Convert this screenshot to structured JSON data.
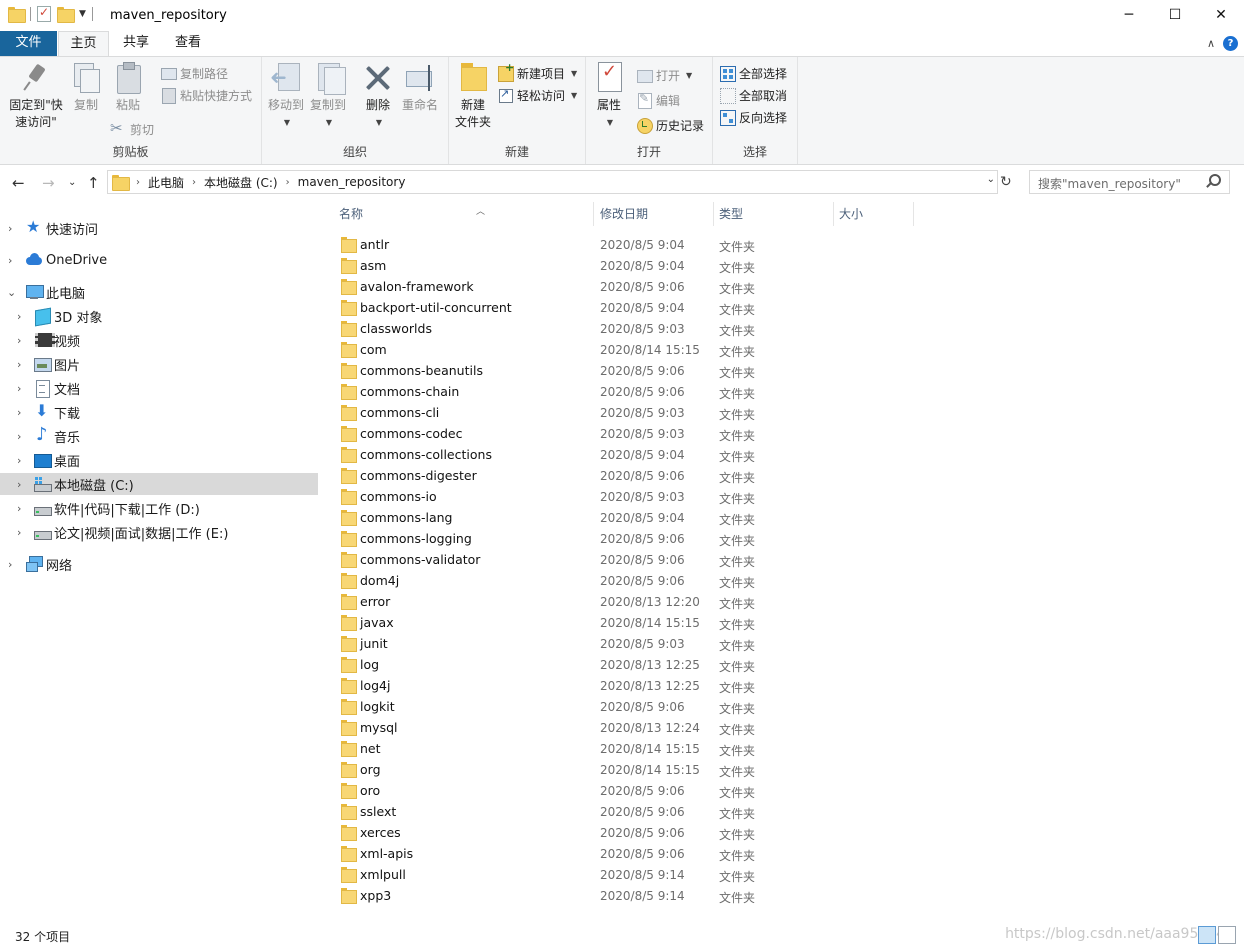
{
  "window": {
    "title": "maven_repository",
    "minimize": "─",
    "maximize": "☐",
    "close": "✕"
  },
  "tabs": {
    "file": "文件",
    "home": "主页",
    "share": "共享",
    "view": "查看",
    "collapse": "∧",
    "help": "?"
  },
  "ribbon": {
    "clipboard": {
      "label": "剪贴板",
      "pin": "固定到\"快\n速访问\"",
      "copy": "复制",
      "paste": "粘贴",
      "copy_path": "复制路径",
      "paste_shortcut": "粘贴快捷方式",
      "cut": "剪切"
    },
    "organize": {
      "label": "组织",
      "move_to": "移动到",
      "copy_to": "复制到",
      "delete": "删除",
      "rename": "重命名"
    },
    "new": {
      "label": "新建",
      "new_folder": "新建\n文件夹",
      "new_item": "新建项目",
      "easy_access": "轻松访问"
    },
    "open": {
      "label": "打开",
      "properties": "属性",
      "open": "打开",
      "edit": "编辑",
      "history": "历史记录"
    },
    "select": {
      "label": "选择",
      "select_all": "全部选择",
      "select_none": "全部取消",
      "invert": "反向选择"
    }
  },
  "address": {
    "crumbs": [
      "此电脑",
      "本地磁盘 (C:)",
      "maven_repository"
    ],
    "search_placeholder": "搜索\"maven_repository\""
  },
  "sidebar": {
    "items": [
      {
        "label": "快速访问"
      },
      {
        "label": "OneDrive"
      },
      {
        "label": "此电脑"
      },
      {
        "label": "3D 对象"
      },
      {
        "label": "视频"
      },
      {
        "label": "图片"
      },
      {
        "label": "文档"
      },
      {
        "label": "下载"
      },
      {
        "label": "音乐"
      },
      {
        "label": "桌面"
      },
      {
        "label": "本地磁盘 (C:)"
      },
      {
        "label": "软件|代码|下载|工作 (D:)"
      },
      {
        "label": "论文|视频|面试|数据|工作 (E:)"
      },
      {
        "label": "网络"
      }
    ]
  },
  "columns": {
    "name": "名称",
    "date": "修改日期",
    "type": "类型",
    "size": "大小"
  },
  "files": [
    {
      "name": "antlr",
      "date": "2020/8/5 9:04",
      "type": "文件夹"
    },
    {
      "name": "asm",
      "date": "2020/8/5 9:04",
      "type": "文件夹"
    },
    {
      "name": "avalon-framework",
      "date": "2020/8/5 9:06",
      "type": "文件夹"
    },
    {
      "name": "backport-util-concurrent",
      "date": "2020/8/5 9:04",
      "type": "文件夹"
    },
    {
      "name": "classworlds",
      "date": "2020/8/5 9:03",
      "type": "文件夹"
    },
    {
      "name": "com",
      "date": "2020/8/14 15:15",
      "type": "文件夹"
    },
    {
      "name": "commons-beanutils",
      "date": "2020/8/5 9:06",
      "type": "文件夹"
    },
    {
      "name": "commons-chain",
      "date": "2020/8/5 9:06",
      "type": "文件夹"
    },
    {
      "name": "commons-cli",
      "date": "2020/8/5 9:03",
      "type": "文件夹"
    },
    {
      "name": "commons-codec",
      "date": "2020/8/5 9:03",
      "type": "文件夹"
    },
    {
      "name": "commons-collections",
      "date": "2020/8/5 9:04",
      "type": "文件夹"
    },
    {
      "name": "commons-digester",
      "date": "2020/8/5 9:06",
      "type": "文件夹"
    },
    {
      "name": "commons-io",
      "date": "2020/8/5 9:03",
      "type": "文件夹"
    },
    {
      "name": "commons-lang",
      "date": "2020/8/5 9:04",
      "type": "文件夹"
    },
    {
      "name": "commons-logging",
      "date": "2020/8/5 9:06",
      "type": "文件夹"
    },
    {
      "name": "commons-validator",
      "date": "2020/8/5 9:06",
      "type": "文件夹"
    },
    {
      "name": "dom4j",
      "date": "2020/8/5 9:06",
      "type": "文件夹"
    },
    {
      "name": "error",
      "date": "2020/8/13 12:20",
      "type": "文件夹"
    },
    {
      "name": "javax",
      "date": "2020/8/14 15:15",
      "type": "文件夹"
    },
    {
      "name": "junit",
      "date": "2020/8/5 9:03",
      "type": "文件夹"
    },
    {
      "name": "log",
      "date": "2020/8/13 12:25",
      "type": "文件夹"
    },
    {
      "name": "log4j",
      "date": "2020/8/13 12:25",
      "type": "文件夹"
    },
    {
      "name": "logkit",
      "date": "2020/8/5 9:06",
      "type": "文件夹"
    },
    {
      "name": "mysql",
      "date": "2020/8/13 12:24",
      "type": "文件夹"
    },
    {
      "name": "net",
      "date": "2020/8/14 15:15",
      "type": "文件夹"
    },
    {
      "name": "org",
      "date": "2020/8/14 15:15",
      "type": "文件夹"
    },
    {
      "name": "oro",
      "date": "2020/8/5 9:06",
      "type": "文件夹"
    },
    {
      "name": "sslext",
      "date": "2020/8/5 9:06",
      "type": "文件夹"
    },
    {
      "name": "xerces",
      "date": "2020/8/5 9:06",
      "type": "文件夹"
    },
    {
      "name": "xml-apis",
      "date": "2020/8/5 9:06",
      "type": "文件夹"
    },
    {
      "name": "xmlpull",
      "date": "2020/8/5 9:14",
      "type": "文件夹"
    },
    {
      "name": "xpp3",
      "date": "2020/8/5 9:14",
      "type": "文件夹"
    }
  ],
  "status": {
    "count": "32 个项目",
    "watermark": "https://blog.csdn.net/aaa958049"
  },
  "colors": {
    "file_tab": "#19659c",
    "selected_nav": "#d9d9d9",
    "folder": "#f8d775"
  }
}
